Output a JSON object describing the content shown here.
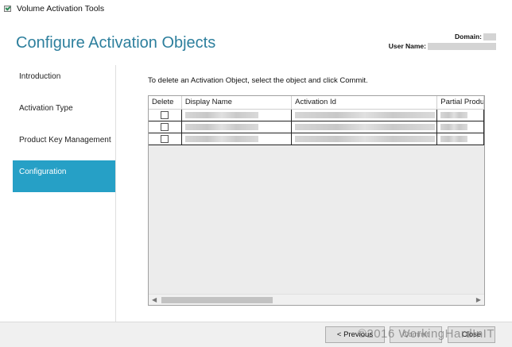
{
  "window": {
    "title": "Volume Activation Tools",
    "icon": "volume-activation-icon"
  },
  "header": {
    "page_title": "Configure Activation Objects",
    "domain_label": "Domain:",
    "user_label": "User Name:"
  },
  "nav": {
    "items": [
      {
        "label": "Introduction"
      },
      {
        "label": "Activation Type"
      },
      {
        "label": "Product Key Management"
      },
      {
        "label": "Configuration",
        "active": true
      }
    ]
  },
  "main": {
    "instruction": "To delete an Activation Object, select the object and click Commit.",
    "table": {
      "columns": [
        "Delete",
        "Display Name",
        "Activation Id",
        "Partial Produ"
      ],
      "rows": [
        {
          "delete_checked": false
        },
        {
          "delete_checked": false
        },
        {
          "delete_checked": false
        }
      ]
    }
  },
  "footer": {
    "previous_label": "< Previous",
    "commit_label": "Commit",
    "close_label": "Close",
    "watermark": "©2016 WorkingHardInIT"
  },
  "colors": {
    "accent": "#26a0c6",
    "title": "#2d7f9d"
  }
}
